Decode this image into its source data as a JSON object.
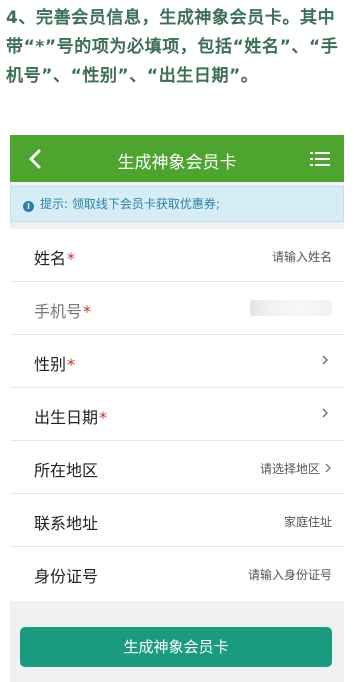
{
  "instruction": {
    "text": "4、完善会员信息，生成神象会员卡。其中带“*”号的项为必填项，包括“姓名”、“手机号”、“性别”、“出生日期”。"
  },
  "navbar": {
    "title": "生成神象会员卡",
    "back_icon": "chevron-left-icon",
    "menu_icon": "menu-icon"
  },
  "tip": {
    "icon": "info-icon",
    "icon_glyph": "i",
    "text": "提示: 领取线下会员卡获取优惠券;"
  },
  "form": {
    "required_mark": "*",
    "fields": [
      {
        "label": "姓名",
        "required": true,
        "placeholder": "请输入姓名"
      },
      {
        "label": "手机号",
        "required": true,
        "value": ""
      },
      {
        "label": "性别",
        "required": true
      },
      {
        "label": "出生日期",
        "required": true
      },
      {
        "label": "所在地区",
        "required": false,
        "placeholder": "请选择地区"
      },
      {
        "label": "联系地址",
        "required": false,
        "placeholder": "家庭住址"
      },
      {
        "label": "身份证号",
        "required": false,
        "placeholder": "请输入身份证号"
      }
    ]
  },
  "submit": {
    "label": "生成神象会员卡"
  },
  "colors": {
    "navbar": "#4da52f",
    "submit": "#1a9a7e",
    "tip_bg": "#d7edf6",
    "instruction_text": "#3d6f55",
    "required": "#c0392b"
  }
}
